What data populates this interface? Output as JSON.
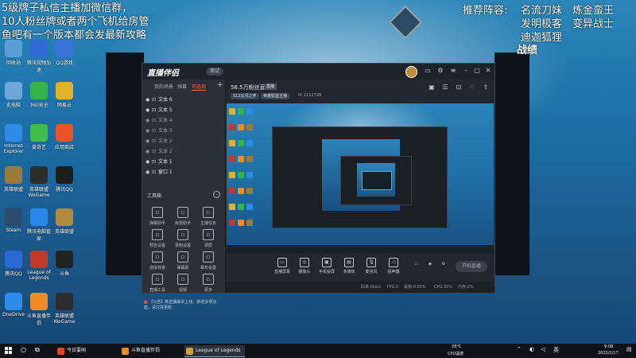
{
  "overlay": {
    "left_lines": [
      "5级牌子私信主播加微信群，",
      "10人粉丝牌或者两个飞机给房管",
      "鱼吧有一个版本都会发最新攻略"
    ],
    "lineup_label": "推荐阵容:",
    "lineup": [
      "名流刀妹",
      "炼金蛮王",
      "发明极客",
      "变异战士",
      "迪迦狐狸"
    ],
    "record_label": "战绩"
  },
  "desktop_icons": [
    {
      "label": "回收站",
      "icon": "recycle-bin-icon",
      "color": "#5a9fd6"
    },
    {
      "label": "腾讯视频加速",
      "icon": "video-icon",
      "color": "#2f6cd6"
    },
    {
      "label": "QQ游戏",
      "icon": "game-icon",
      "color": "#3b73d9"
    },
    {
      "label": "此电脑",
      "icon": "computer-icon",
      "color": "#6fa6d8"
    },
    {
      "label": "360安全",
      "icon": "shield-icon",
      "color": "#35b34a"
    },
    {
      "label": "网易云",
      "icon": "music-icon",
      "color": "#e0b22a"
    },
    {
      "label": "Internet Explorer",
      "icon": "ie-icon",
      "color": "#2f8be8"
    },
    {
      "label": "爱奇艺",
      "icon": "play-icon",
      "color": "#3fbf4a"
    },
    {
      "label": "应用商店",
      "icon": "store-icon",
      "color": "#e8542a"
    },
    {
      "label": "英雄联盟",
      "icon": "lol-icon",
      "color": "#9b7a3b"
    },
    {
      "label": "英雄联盟WeGame",
      "icon": "lol-icon",
      "color": "#2c2c2c"
    },
    {
      "label": "腾讯QQ",
      "icon": "qq-icon",
      "color": "#1d1d1d"
    },
    {
      "label": "Steam",
      "icon": "steam-icon",
      "color": "#2a4a6e"
    },
    {
      "label": "腾讯电脑管家",
      "icon": "guard-icon",
      "color": "#2a86e8"
    },
    {
      "label": "英雄联盟",
      "icon": "lol-icon",
      "color": "#b08a3e"
    },
    {
      "label": "腾讯QQ",
      "icon": "qq-icon",
      "color": "#2b6ad6"
    },
    {
      "label": "League of Legends",
      "icon": "lol-icon",
      "color": "#c0392b"
    },
    {
      "label": "斗鱼",
      "icon": "douyu-icon",
      "color": "#222222"
    },
    {
      "label": "OneDrive",
      "icon": "cloud-icon",
      "color": "#2f8be8"
    },
    {
      "label": "斗鱼直播伴侣",
      "icon": "live-icon",
      "color": "#f08a24"
    },
    {
      "label": "英雄联盟WeGame",
      "icon": "lol-icon",
      "color": "#2c2c2c"
    }
  ],
  "app": {
    "logo": "直播伴侣",
    "version_badge": "测试",
    "tabs": [
      "我的场景",
      "弹幕",
      "可选项"
    ],
    "active_tab_index": 2,
    "sources": [
      {
        "label": "文本 6",
        "on": true
      },
      {
        "label": "文本 5",
        "on": true
      },
      {
        "label": "文本 4",
        "on": false
      },
      {
        "label": "文本 3",
        "on": false
      },
      {
        "label": "文本 2",
        "on": false
      },
      {
        "label": "文本 2",
        "on": false
      },
      {
        "label": "文本 1",
        "on": true
      },
      {
        "label": "窗口 1",
        "on": true
      }
    ],
    "tools_title": "工具箱",
    "tools": [
      {
        "label": "弹幕助手",
        "icon": "chat-icon"
      },
      {
        "label": "房管助手",
        "icon": "user-icon"
      },
      {
        "label": "主播任务",
        "icon": "task-icon"
      },
      {
        "label": "预告设置",
        "icon": "notice-icon"
      },
      {
        "label": "录制设置",
        "icon": "download-icon"
      },
      {
        "label": "录屏",
        "icon": "record-icon"
      },
      {
        "label": "虚拟背景",
        "icon": "background-icon"
      },
      {
        "label": "弹幕姬",
        "icon": "danmaku-icon"
      },
      {
        "label": "幕布设置",
        "icon": "screen-icon"
      },
      {
        "label": "直播工具",
        "icon": "tool-icon"
      },
      {
        "label": "视频",
        "icon": "video-icon"
      },
      {
        "label": "更多",
        "icon": "more-icon"
      }
    ],
    "room": {
      "title": "56.5万粉丝直播",
      "tag": "直播",
      "chips": [
        "S12云顶之弈",
        "英雄联盟主播"
      ],
      "room_id": "ID 2112728"
    },
    "bottom_controls": [
      {
        "label": "直播屏幕",
        "icon": "monitor-icon"
      },
      {
        "label": "摄像头",
        "icon": "camera-icon"
      },
      {
        "label": "手机投屏",
        "icon": "phone-icon"
      },
      {
        "label": "多媒体",
        "icon": "media-icon"
      },
      {
        "label": "麦克风",
        "icon": "mic-icon"
      },
      {
        "label": "扬声器",
        "icon": "speaker-icon"
      }
    ],
    "go_live_label": "开始直播",
    "status_items": [
      "码率:0kb/s",
      "FPS:0",
      "丢帧:0.00%",
      "CPU:35%",
      "内存:0%"
    ],
    "notice": "【公告】新直播版本上线，新增多项功能，请注意更新"
  },
  "taskbar": {
    "items": [
      {
        "label": "今日要闻",
        "color": "#d84a2a",
        "active": false
      },
      {
        "label": "斗鱼直播伴侣",
        "color": "#f08a24",
        "active": false
      },
      {
        "label": "League of Legends",
        "color": "#c9a23a",
        "active": true
      }
    ],
    "temperature": "28°C",
    "cpu_temp": "CPU温度",
    "time": "9:08",
    "date": "2022/2/17"
  }
}
